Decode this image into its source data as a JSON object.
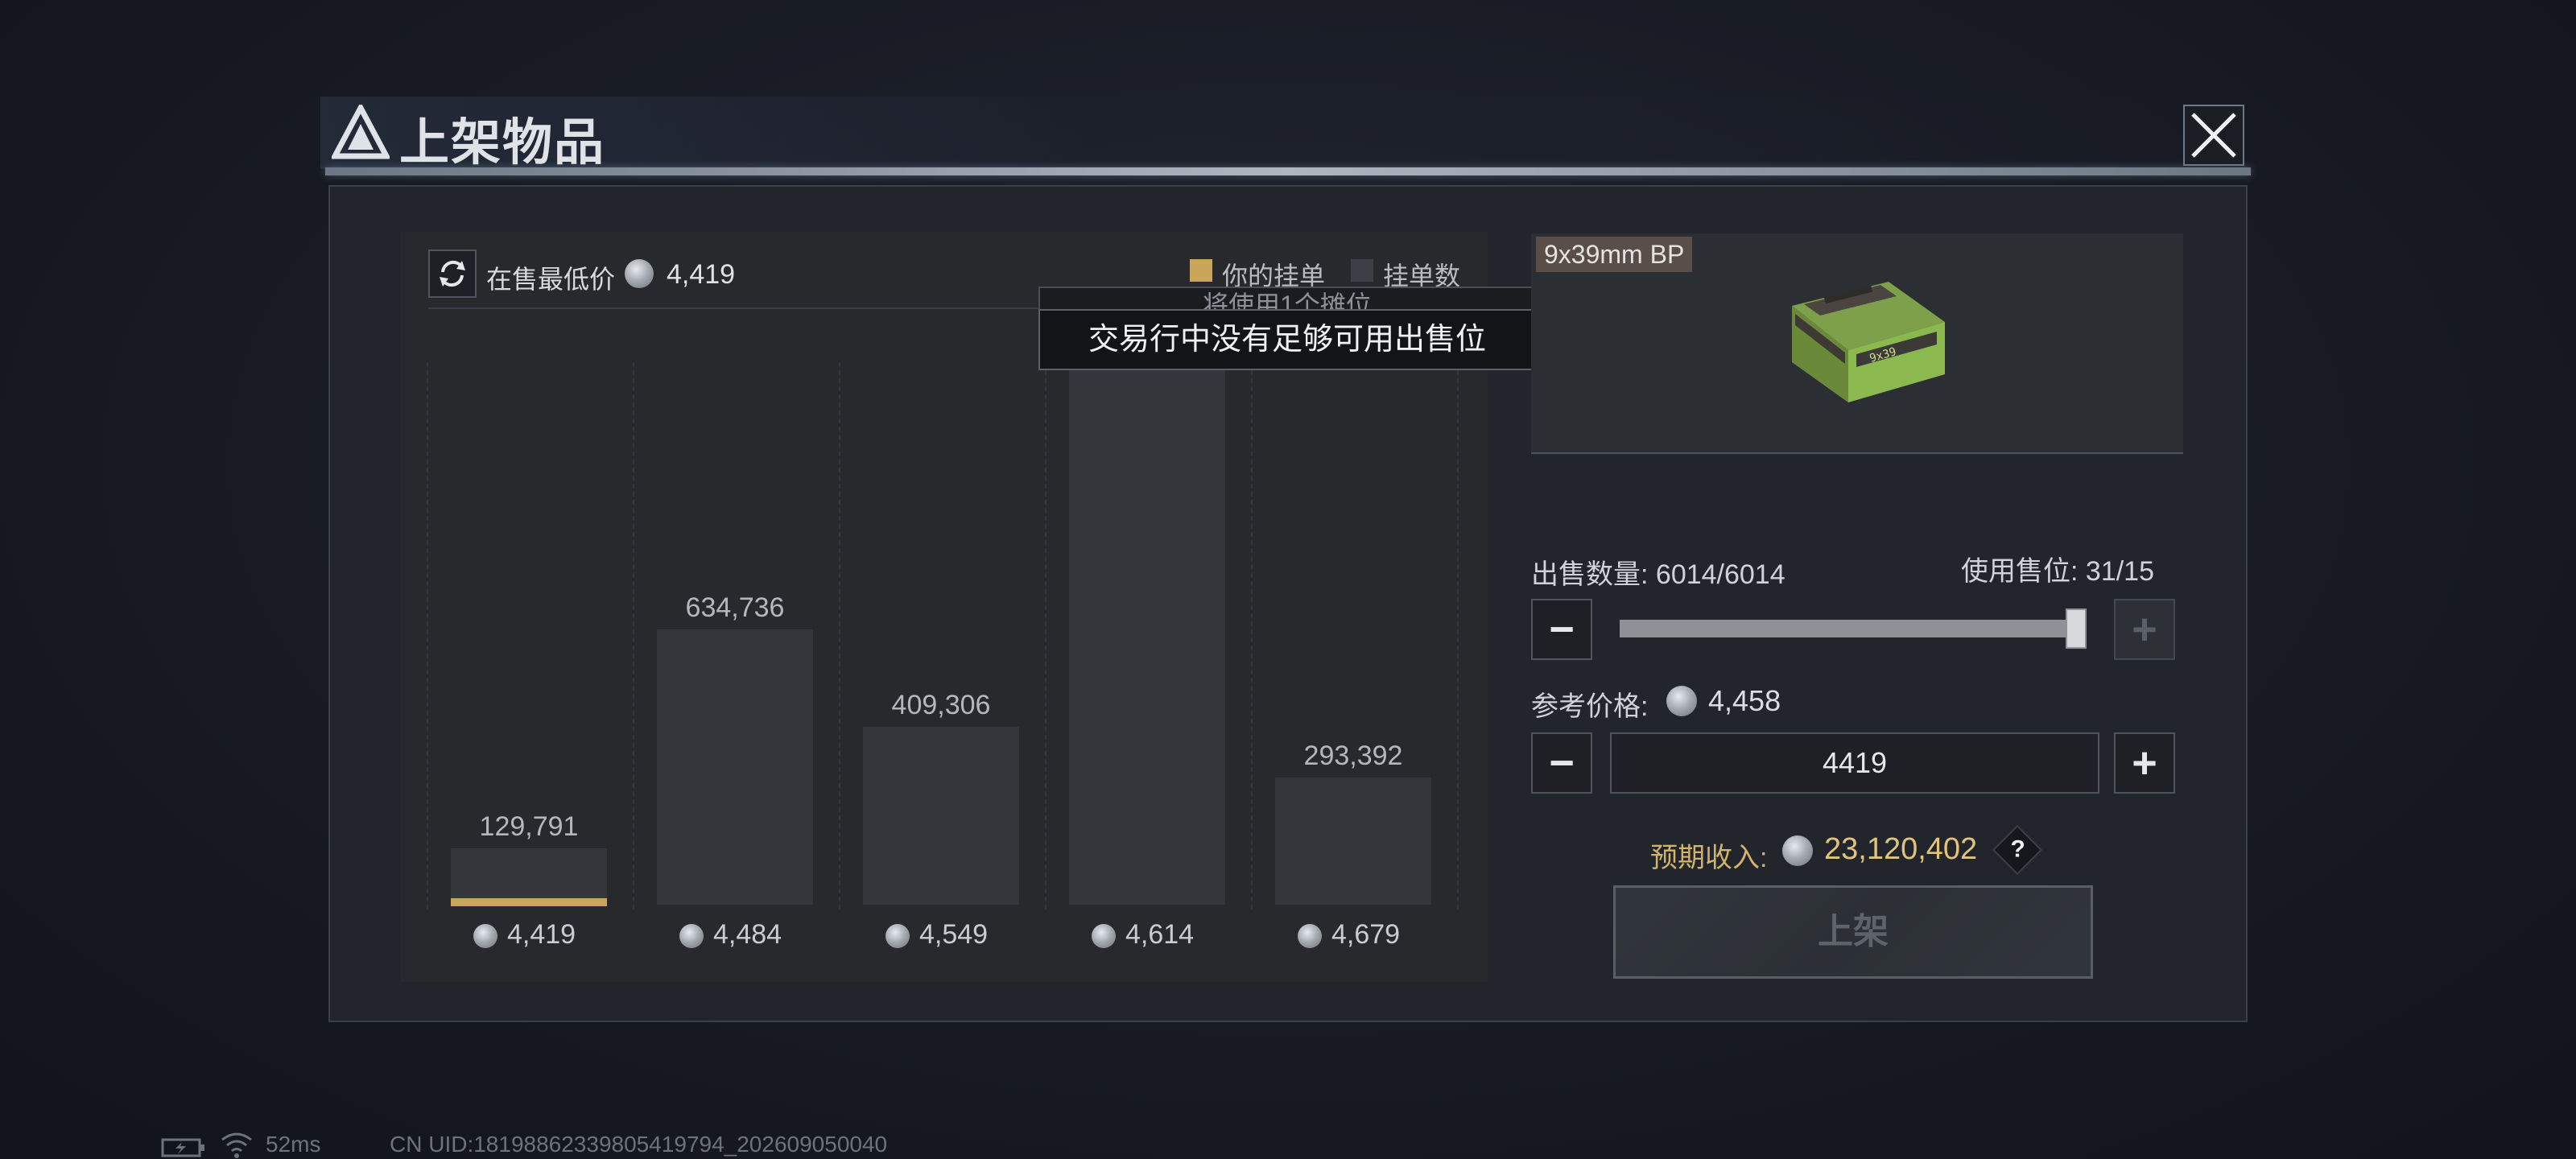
{
  "dialog": {
    "title": "上架物品"
  },
  "chart_panel": {
    "refresh_icon": "refresh-icon",
    "lowest_price_label": "在售最低价",
    "lowest_price_value": "4,419",
    "legend": {
      "yours": "你的挂单",
      "count": "挂单数",
      "yours_color": "#c9a55a",
      "count_color": "#3c3f45"
    }
  },
  "tooltip": {
    "behind_text": "将使用1个摊位",
    "text": "交易行中没有足够可用出售位"
  },
  "chart_data": {
    "type": "bar",
    "categories": [
      "4,419",
      "4,484",
      "4,549",
      "4,614",
      "4,679"
    ],
    "values": [
      129791,
      634736,
      409306,
      null,
      293392
    ],
    "value_labels": [
      "129,791",
      "634,736",
      "409,306",
      "",
      "293,392"
    ],
    "your_listing_category": "4,419"
  },
  "item": {
    "name": "9x39mm BP"
  },
  "sell": {
    "quantity_label": "出售数量: ",
    "quantity_value": "6014/6014",
    "slots_label": "使用售位: ",
    "slots_value": "31/15",
    "quantity_fraction": 1.0,
    "ref_price_label": "参考价格: ",
    "ref_price_value": "4,458",
    "price_input_value": "4419",
    "income_label": "预期收入: ",
    "income_value": "23,120,402",
    "help": "?",
    "list_button": "上架"
  },
  "status_bar": {
    "ping": "52ms",
    "uid": "CN UID:18198862339805419794_202609050040"
  }
}
